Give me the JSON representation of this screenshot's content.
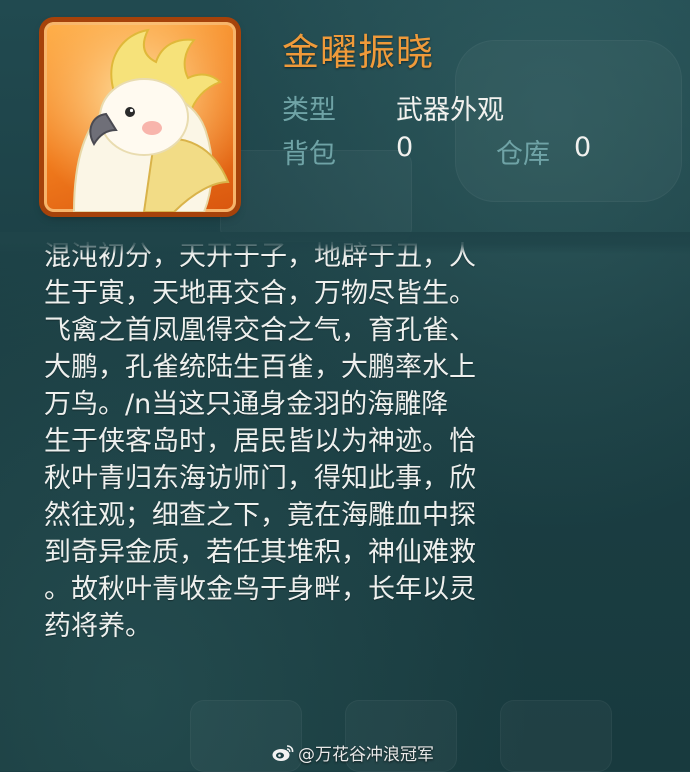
{
  "item": {
    "name": "金曜振晓",
    "icon": "white-golden-crested-bird-portrait",
    "type_label": "类型",
    "type_value": "武器外观",
    "bag_label": "背包",
    "bag_count": "0",
    "warehouse_label": "仓库",
    "warehouse_count": "0"
  },
  "description": "混沌初分，天开于子，地辟于丑，人\n生于寅，天地再交合，万物尽皆生。\n飞禽之首凤凰得交合之气，育孔雀、\n大鹏，孔雀统陆生百雀，大鹏率水上\n万鸟。/n当这只通身金羽的海雕降\n生于侠客岛时，居民皆以为神迹。恰\n秋叶青归东海访师门，得知此事，欣\n然往观；细查之下，竟在海雕血中探\n到奇异金质，若任其堆积，神仙难救\n。故秋叶青收金鸟于身畔，长年以灵\n药将养。",
  "watermark": {
    "icon": "weibo-icon",
    "text": "@万花谷冲浪冠军"
  },
  "colors": {
    "title": "#ef9a3a",
    "label": "#6fa3a6",
    "value": "#f1f1ee",
    "frame": "#f07a1c",
    "panel": "#1c3f44"
  }
}
